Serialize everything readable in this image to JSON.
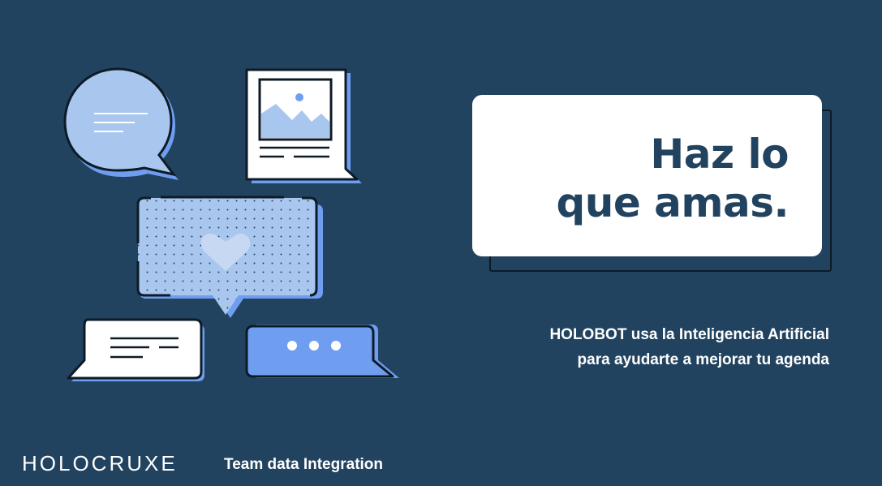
{
  "headline": {
    "line1": "Haz lo",
    "line2": "que amas."
  },
  "tagline": {
    "line1": "HOLOBOT usa la Inteligencia Artificial",
    "line2": "para ayudarte a mejorar tu agenda"
  },
  "footer": {
    "logo_text": "HOLOCRUXE",
    "team_label": "Team data Integration"
  },
  "colors": {
    "background": "#22435f",
    "card": "#ffffff",
    "headline_text": "#22435f",
    "bubble_light_blue": "#a9c6ee",
    "bubble_blue": "#6f9ef0",
    "outline": "#0d1b27"
  },
  "icons": [
    "speech-bubble-icon",
    "image-card-icon",
    "heart-bubble-icon",
    "text-bubble-icon",
    "typing-bubble-icon"
  ]
}
